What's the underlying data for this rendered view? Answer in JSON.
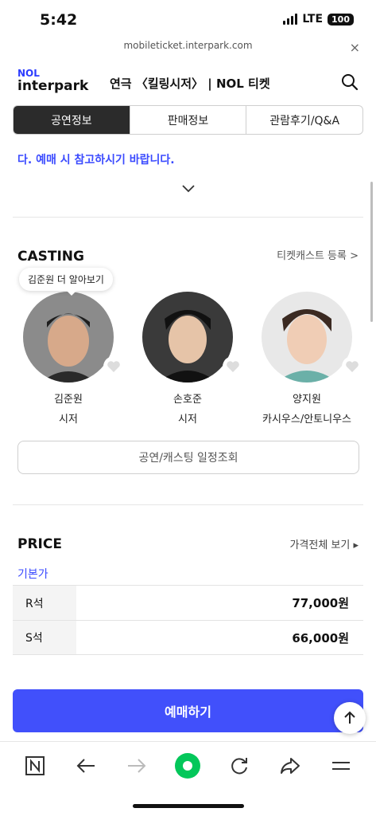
{
  "status": {
    "time": "5:42",
    "network": "LTE",
    "battery": "100"
  },
  "browser": {
    "url": "mobileticket.interpark.com",
    "close": "×"
  },
  "header": {
    "logo_top": "NOL",
    "logo_bottom": "interpark",
    "title": "연극 〈킬링시저〉 | NOL 티켓"
  },
  "tabs": [
    {
      "label": "공연정보",
      "active": true
    },
    {
      "label": "판매정보",
      "active": false
    },
    {
      "label": "관람후기/Q&A",
      "active": false
    }
  ],
  "notice": "다. 예매 시 참고하시기 바랍니다.",
  "casting": {
    "title": "CASTING",
    "ticketcast_link": "티켓캐스트 등록 >",
    "tooltip": "김준원 더 알아보기",
    "cast": [
      {
        "name": "김준원",
        "role": "시저"
      },
      {
        "name": "손호준",
        "role": "시저"
      },
      {
        "name": "양지원",
        "role": "카시우스/안토니우스"
      }
    ],
    "schedule_button": "공연/캐스팅 일정조회"
  },
  "price": {
    "title": "PRICE",
    "all_link": "가격전체 보기 ▸",
    "base_label": "기본가",
    "rows": [
      {
        "seat": "R석",
        "amount": "77,000원"
      },
      {
        "seat": "S석",
        "amount": "66,000원"
      }
    ]
  },
  "book_button": "예매하기",
  "colors": {
    "accent": "#4150fb",
    "link_blue": "#3b4bff",
    "active_tab": "#2b2b2b",
    "naver_green": "#03c75a"
  }
}
